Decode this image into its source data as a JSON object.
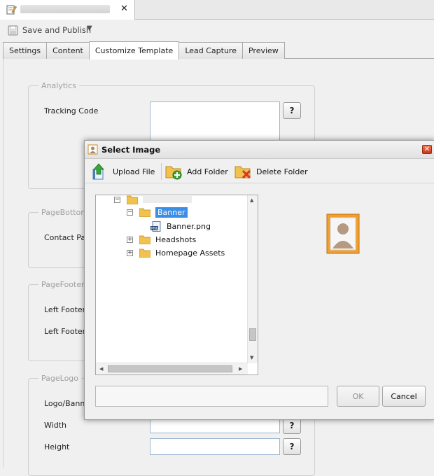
{
  "doc_tab": {
    "close_label": "✕"
  },
  "toolbar": {
    "save_label": "Save and Publish",
    "caret": "▼"
  },
  "tabs": [
    {
      "label": "Settings"
    },
    {
      "label": "Content"
    },
    {
      "label": "Customize Template",
      "active": true
    },
    {
      "label": "Lead Capture"
    },
    {
      "label": "Preview"
    }
  ],
  "sections": {
    "analytics": {
      "legend": "Analytics",
      "tracking_code_label": "Tracking Code",
      "help": "?"
    },
    "page_bottom": {
      "legend": "PageBottom",
      "contact_label": "Contact Pag"
    },
    "page_footer": {
      "legend": "PageFooter",
      "left_footer_1": "Left Footer",
      "left_footer_2": "Left Footer"
    },
    "page_logo": {
      "legend": "PageLogo",
      "logo_label": "Logo/Banne",
      "width_label": "Width",
      "height_label": "Height",
      "help": "?"
    }
  },
  "dialog": {
    "title": "Select Image",
    "close": "✕",
    "tools": {
      "upload": "Upload File",
      "add_folder": "Add Folder",
      "delete_folder": "Delete Folder"
    },
    "tree": {
      "banner_folder": "Banner",
      "banner_file": "Banner.png",
      "headshots": "Headshots",
      "homepage_assets": "Homepage Assets"
    },
    "ok_label": "OK",
    "cancel_label": "Cancel"
  },
  "colors": {
    "selection": "#3a8ee6",
    "folder": "#f2c14e",
    "accent_green": "#3aa63a",
    "delete_red": "#d9332b"
  }
}
